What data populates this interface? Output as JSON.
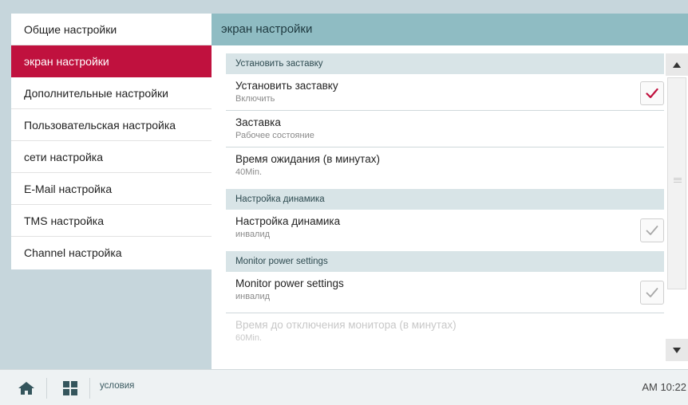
{
  "sidebar": {
    "items": [
      {
        "label": "Общие настройки",
        "active": false
      },
      {
        "label": "экран настройки",
        "active": true
      },
      {
        "label": "Дополнительные настройки",
        "active": false
      },
      {
        "label": "Пользовательская настройка",
        "active": false
      },
      {
        "label": "сети настройка",
        "active": false
      },
      {
        "label": "E-Mail настройка",
        "active": false
      },
      {
        "label": "TMS настройка",
        "active": false
      },
      {
        "label": "Channel настройка",
        "active": false
      }
    ]
  },
  "main": {
    "title": "экран настройки",
    "sections": [
      {
        "header": "Установить заставку",
        "rows": [
          {
            "title": "Установить заставку",
            "sub": "Включить",
            "checkbox": "checked-red"
          },
          {
            "title": "Заставка",
            "sub": "Рабочее состояние"
          },
          {
            "title": "Время ожидания (в минутах)",
            "sub": "40Min."
          }
        ]
      },
      {
        "header": "Настройка динамика",
        "rows": [
          {
            "title": "Настройка динамика",
            "sub": "инвалид",
            "checkbox": "checked-gray"
          }
        ]
      },
      {
        "header": "Monitor power settings",
        "rows": [
          {
            "title": "Monitor power settings",
            "sub": "инвалид",
            "checkbox": "checked-gray"
          },
          {
            "title": "Время до отключения монитора (в минутах)",
            "sub": "60Min.",
            "disabled": true
          }
        ]
      }
    ]
  },
  "bottom": {
    "status_label": "условия",
    "clock": "AM 10:22",
    "home_icon": "home-icon",
    "menu_icon": "grid-menu-icon"
  },
  "colors": {
    "accent": "#c0113e",
    "header_bg": "#8fbcc3",
    "background": "#c6d6dc",
    "check_red": "#c0113e",
    "check_gray": "#a8a8a8"
  }
}
